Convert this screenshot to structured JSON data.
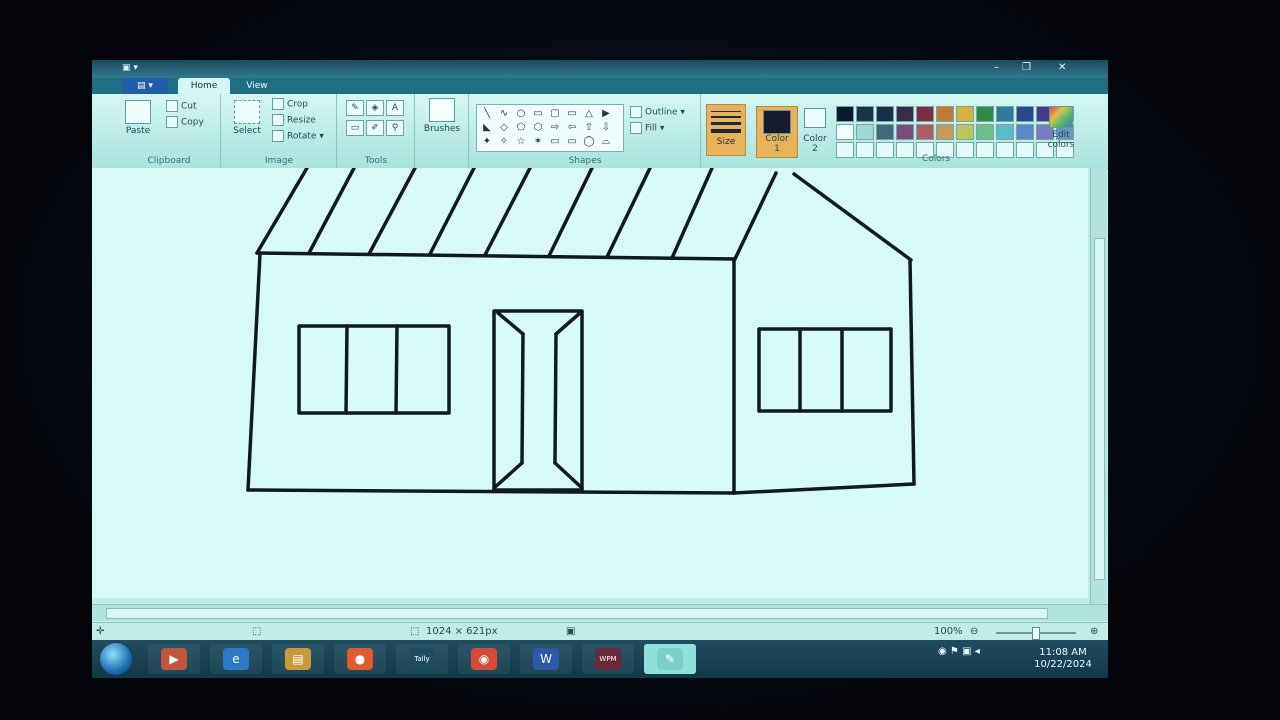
{
  "window": {
    "quick_access": "▣ ▾",
    "controls": [
      "–",
      "❐",
      "✕"
    ]
  },
  "tabs": {
    "file": "▤ ▾",
    "home": "Home",
    "view": "View"
  },
  "ribbon": {
    "clipboard": {
      "title": "Clipboard",
      "paste": "Paste",
      "cut": "Cut",
      "copy": "Copy"
    },
    "image": {
      "title": "Image",
      "select": "Select",
      "crop": "Crop",
      "resize": "Resize",
      "rotate": "Rotate ▾"
    },
    "tools": {
      "title": "Tools",
      "pencil": "✎",
      "fill": "◈",
      "text": "A",
      "eraser": "▭",
      "picker": "✐",
      "magnifier": "⚲"
    },
    "brushes": {
      "label": "Brushes"
    },
    "shapes": {
      "title": "Shapes",
      "glyphs": [
        "╲",
        "∿",
        "○",
        "▭",
        "▢",
        "▭",
        "△",
        "▶",
        "◣",
        "◇",
        "⬠",
        "⬡",
        "⇨",
        "⇦",
        "⇧",
        "⇩",
        "✦",
        "✧",
        "☆",
        "✶",
        "▭",
        "▭",
        "◯",
        "⌓"
      ],
      "outline": "Outline ▾",
      "fill": "Fill ▾"
    },
    "size": {
      "label": "Size"
    },
    "color1": {
      "label": "Color",
      "num": "1",
      "swatch": "#141c2e"
    },
    "color2": {
      "label": "Color",
      "num": "2",
      "swatch": "#e8fdfb"
    },
    "colors": {
      "title": "Colors",
      "row1": [
        "#0b1a2a",
        "#1c3347",
        "#1a2f46",
        "#3a2b4a",
        "#7a3040",
        "#c07a3a",
        "#d6b23a",
        "#2f8a4a",
        "#2f7a9a",
        "#2a4a8a",
        "#4a3a8a",
        "#0f2a4a"
      ],
      "row2": [
        "#f2fffd",
        "#9fd8d4",
        "#3e6a7a",
        "#7a4a78",
        "#b05a6a",
        "#c89a5a",
        "#b8c65a",
        "#6ac08a",
        "#5abcc8",
        "#5a8ac8",
        "#7a7ac0",
        "#6a96b8"
      ],
      "edit": "Edit colors"
    }
  },
  "status": {
    "dimensions": "1024 × 621px",
    "zoom": "100%"
  },
  "taskbar": {
    "apps": [
      {
        "name": "media-player",
        "label": "▶",
        "color": "#c0563a"
      },
      {
        "name": "internet-explorer",
        "label": "e",
        "color": "#2a7ac8"
      },
      {
        "name": "explorer",
        "label": "▤",
        "color": "#c89a3a"
      },
      {
        "name": "firefox",
        "label": "●",
        "color": "#e05a2a"
      },
      {
        "name": "tally",
        "label": "Tally",
        "color": "#1f4d60"
      },
      {
        "name": "chrome",
        "label": "◉",
        "color": "#d64a3a"
      },
      {
        "name": "word",
        "label": "W",
        "color": "#2a5aa8"
      },
      {
        "name": "wpm",
        "label": "WPM",
        "color": "#6a2a3a"
      },
      {
        "name": "paint",
        "label": "✎",
        "color": "#7ad0c8"
      }
    ],
    "time": "11:08 AM",
    "date": "10/22/2024"
  }
}
